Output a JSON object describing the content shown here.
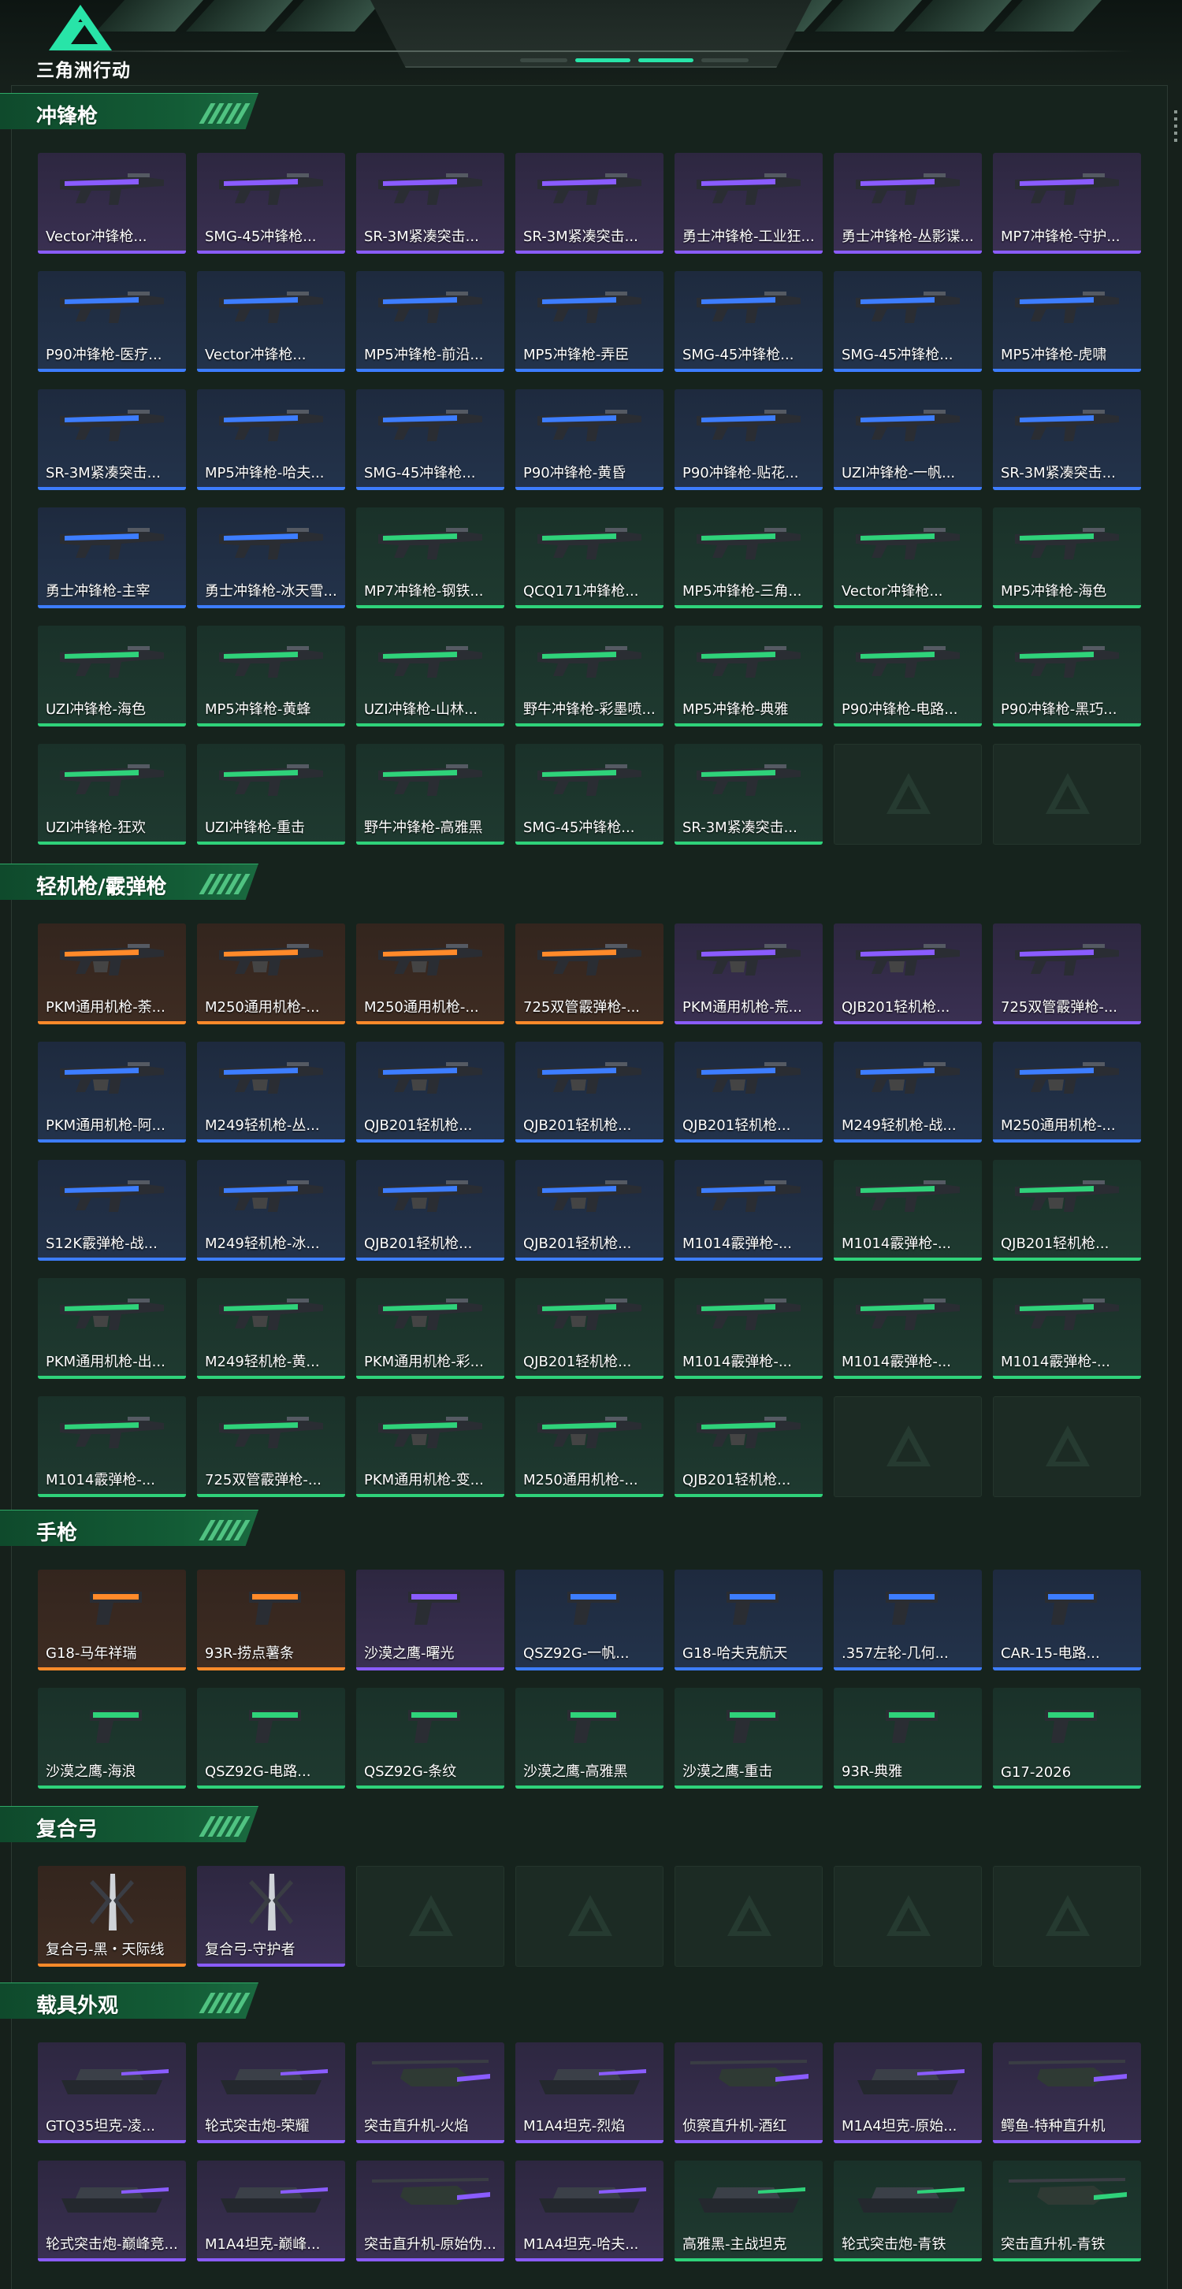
{
  "header": {
    "logo_text": "三角洲行动",
    "accent_color": "#28e4a8"
  },
  "rarity_colors": {
    "purple": "#8a5cff",
    "blue": "#3d7dff",
    "green": "#2fd27a",
    "orange": "#ff8a2a"
  },
  "sections": [
    {
      "title": "冲锋枪",
      "items": [
        {
          "label": "Vector冲锋枪...",
          "rarity": "purple",
          "icon": "smg-icon"
        },
        {
          "label": "SMG-45冲锋枪...",
          "rarity": "purple",
          "icon": "smg-icon"
        },
        {
          "label": "SR-3M紧凑突击...",
          "rarity": "purple",
          "icon": "smg-icon"
        },
        {
          "label": "SR-3M紧凑突击...",
          "rarity": "purple",
          "icon": "smg-icon"
        },
        {
          "label": "勇士冲锋枪-工业狂...",
          "rarity": "purple",
          "icon": "smg-icon"
        },
        {
          "label": "勇士冲锋枪-丛影谍...",
          "rarity": "purple",
          "icon": "smg-icon"
        },
        {
          "label": "MP7冲锋枪-守护...",
          "rarity": "purple",
          "icon": "smg-icon"
        },
        {
          "label": "P90冲锋枪-医疗...",
          "rarity": "blue",
          "icon": "smg-icon"
        },
        {
          "label": "Vector冲锋枪...",
          "rarity": "blue",
          "icon": "smg-icon"
        },
        {
          "label": "MP5冲锋枪-前沿...",
          "rarity": "blue",
          "icon": "smg-icon"
        },
        {
          "label": "MP5冲锋枪-弄臣",
          "rarity": "blue",
          "icon": "smg-icon"
        },
        {
          "label": "SMG-45冲锋枪...",
          "rarity": "blue",
          "icon": "smg-icon"
        },
        {
          "label": "SMG-45冲锋枪...",
          "rarity": "blue",
          "icon": "smg-icon"
        },
        {
          "label": "MP5冲锋枪-虎啸",
          "rarity": "blue",
          "icon": "smg-icon"
        },
        {
          "label": "SR-3M紧凑突击...",
          "rarity": "blue",
          "icon": "smg-icon"
        },
        {
          "label": "MP5冲锋枪-哈夫...",
          "rarity": "blue",
          "icon": "smg-icon"
        },
        {
          "label": "SMG-45冲锋枪...",
          "rarity": "blue",
          "icon": "smg-icon"
        },
        {
          "label": "P90冲锋枪-黄昏",
          "rarity": "blue",
          "icon": "smg-icon"
        },
        {
          "label": "P90冲锋枪-贴花...",
          "rarity": "blue",
          "icon": "smg-icon"
        },
        {
          "label": "UZI冲锋枪-一帆...",
          "rarity": "blue",
          "icon": "smg-icon"
        },
        {
          "label": "SR-3M紧凑突击...",
          "rarity": "blue",
          "icon": "smg-icon"
        },
        {
          "label": "勇士冲锋枪-主宰",
          "rarity": "blue",
          "icon": "smg-icon"
        },
        {
          "label": "勇士冲锋枪-冰天雪...",
          "rarity": "blue",
          "icon": "smg-icon"
        },
        {
          "label": "MP7冲锋枪-钢铁...",
          "rarity": "green",
          "icon": "smg-icon"
        },
        {
          "label": "QCQ171冲锋枪...",
          "rarity": "green",
          "icon": "smg-icon"
        },
        {
          "label": "MP5冲锋枪-三角...",
          "rarity": "green",
          "icon": "smg-icon"
        },
        {
          "label": "Vector冲锋枪...",
          "rarity": "green",
          "icon": "smg-icon"
        },
        {
          "label": "MP5冲锋枪-海色",
          "rarity": "green",
          "icon": "smg-icon"
        },
        {
          "label": "UZI冲锋枪-海色",
          "rarity": "green",
          "icon": "smg-icon"
        },
        {
          "label": "MP5冲锋枪-黄蜂",
          "rarity": "green",
          "icon": "smg-icon"
        },
        {
          "label": "UZI冲锋枪-山林...",
          "rarity": "green",
          "icon": "smg-icon"
        },
        {
          "label": "野牛冲锋枪-彩墨喷...",
          "rarity": "green",
          "icon": "smg-icon"
        },
        {
          "label": "MP5冲锋枪-典雅",
          "rarity": "green",
          "icon": "smg-icon"
        },
        {
          "label": "P90冲锋枪-电路...",
          "rarity": "green",
          "icon": "smg-icon"
        },
        {
          "label": "P90冲锋枪-黑巧...",
          "rarity": "green",
          "icon": "smg-icon"
        },
        {
          "label": "UZI冲锋枪-狂欢",
          "rarity": "green",
          "icon": "smg-icon"
        },
        {
          "label": "UZI冲锋枪-重击",
          "rarity": "green",
          "icon": "smg-icon"
        },
        {
          "label": "野牛冲锋枪-高雅黑",
          "rarity": "green",
          "icon": "smg-icon"
        },
        {
          "label": "SMG-45冲锋枪...",
          "rarity": "green",
          "icon": "smg-icon"
        },
        {
          "label": "SR-3M紧凑突击...",
          "rarity": "green",
          "icon": "smg-icon"
        },
        {
          "label": "",
          "rarity": "empty",
          "icon": "delta-logo-icon"
        },
        {
          "label": "",
          "rarity": "empty",
          "icon": "delta-logo-icon"
        }
      ]
    },
    {
      "title": "轻机枪/霰弹枪",
      "items": [
        {
          "label": "PKM通用机枪-荼...",
          "rarity": "orange",
          "icon": "lmg-icon"
        },
        {
          "label": "M250通用机枪-...",
          "rarity": "orange",
          "icon": "lmg-icon"
        },
        {
          "label": "M250通用机枪-...",
          "rarity": "orange",
          "icon": "lmg-icon"
        },
        {
          "label": "725双管霰弹枪-...",
          "rarity": "orange",
          "icon": "shotgun-icon"
        },
        {
          "label": "PKM通用机枪-荒...",
          "rarity": "purple",
          "icon": "lmg-icon"
        },
        {
          "label": "QJB201轻机枪...",
          "rarity": "purple",
          "icon": "lmg-icon"
        },
        {
          "label": "725双管霰弹枪-...",
          "rarity": "purple",
          "icon": "shotgun-icon"
        },
        {
          "label": "PKM通用机枪-阿...",
          "rarity": "blue",
          "icon": "lmg-icon"
        },
        {
          "label": "M249轻机枪-丛...",
          "rarity": "blue",
          "icon": "lmg-icon"
        },
        {
          "label": "QJB201轻机枪...",
          "rarity": "blue",
          "icon": "lmg-icon"
        },
        {
          "label": "QJB201轻机枪...",
          "rarity": "blue",
          "icon": "lmg-icon"
        },
        {
          "label": "QJB201轻机枪...",
          "rarity": "blue",
          "icon": "lmg-icon"
        },
        {
          "label": "M249轻机枪-战...",
          "rarity": "blue",
          "icon": "lmg-icon"
        },
        {
          "label": "M250通用机枪-...",
          "rarity": "blue",
          "icon": "lmg-icon"
        },
        {
          "label": "S12K霰弹枪-战...",
          "rarity": "blue",
          "icon": "shotgun-icon"
        },
        {
          "label": "M249轻机枪-冰...",
          "rarity": "blue",
          "icon": "lmg-icon"
        },
        {
          "label": "QJB201轻机枪...",
          "rarity": "blue",
          "icon": "lmg-icon"
        },
        {
          "label": "QJB201轻机枪...",
          "rarity": "blue",
          "icon": "lmg-icon"
        },
        {
          "label": "M1014霰弹枪-...",
          "rarity": "blue",
          "icon": "shotgun-icon"
        },
        {
          "label": "M1014霰弹枪-...",
          "rarity": "green",
          "icon": "shotgun-icon"
        },
        {
          "label": "QJB201轻机枪...",
          "rarity": "green",
          "icon": "lmg-icon"
        },
        {
          "label": "PKM通用机枪-出...",
          "rarity": "green",
          "icon": "lmg-icon"
        },
        {
          "label": "M249轻机枪-黄...",
          "rarity": "green",
          "icon": "lmg-icon"
        },
        {
          "label": "PKM通用机枪-彩...",
          "rarity": "green",
          "icon": "lmg-icon"
        },
        {
          "label": "QJB201轻机枪...",
          "rarity": "green",
          "icon": "lmg-icon"
        },
        {
          "label": "M1014霰弹枪-...",
          "rarity": "green",
          "icon": "shotgun-icon"
        },
        {
          "label": "M1014霰弹枪-...",
          "rarity": "green",
          "icon": "shotgun-icon"
        },
        {
          "label": "M1014霰弹枪-...",
          "rarity": "green",
          "icon": "shotgun-icon"
        },
        {
          "label": "M1014霰弹枪-...",
          "rarity": "green",
          "icon": "shotgun-icon"
        },
        {
          "label": "725双管霰弹枪-...",
          "rarity": "green",
          "icon": "shotgun-icon"
        },
        {
          "label": "PKM通用机枪-变...",
          "rarity": "green",
          "icon": "lmg-icon"
        },
        {
          "label": "M250通用机枪-...",
          "rarity": "green",
          "icon": "lmg-icon"
        },
        {
          "label": "QJB201轻机枪...",
          "rarity": "green",
          "icon": "lmg-icon"
        },
        {
          "label": "",
          "rarity": "empty",
          "icon": "delta-logo-icon"
        },
        {
          "label": "",
          "rarity": "empty",
          "icon": "delta-logo-icon"
        }
      ]
    },
    {
      "title": "手枪",
      "items": [
        {
          "label": "G18-马年祥瑞",
          "rarity": "orange",
          "icon": "pistol-icon"
        },
        {
          "label": "93R-捞点薯条",
          "rarity": "orange",
          "icon": "pistol-icon"
        },
        {
          "label": "沙漠之鹰-曙光",
          "rarity": "purple",
          "icon": "pistol-icon"
        },
        {
          "label": "QSZ92G-一帆...",
          "rarity": "blue",
          "icon": "pistol-icon"
        },
        {
          "label": "G18-哈夫克航天",
          "rarity": "blue",
          "icon": "pistol-icon"
        },
        {
          "label": ".357左轮-几何...",
          "rarity": "blue",
          "icon": "revolver-icon"
        },
        {
          "label": "CAR-15-电路...",
          "rarity": "blue",
          "icon": "pistol-icon"
        },
        {
          "label": "沙漠之鹰-海浪",
          "rarity": "green",
          "icon": "pistol-icon"
        },
        {
          "label": "QSZ92G-电路...",
          "rarity": "green",
          "icon": "pistol-icon"
        },
        {
          "label": "QSZ92G-条纹",
          "rarity": "green",
          "icon": "pistol-icon"
        },
        {
          "label": "沙漠之鹰-高雅黑",
          "rarity": "green",
          "icon": "pistol-icon"
        },
        {
          "label": "沙漠之鹰-重击",
          "rarity": "green",
          "icon": "pistol-icon"
        },
        {
          "label": "93R-典雅",
          "rarity": "green",
          "icon": "pistol-icon"
        },
        {
          "label": "G17-2026",
          "rarity": "green",
          "icon": "pistol-icon"
        }
      ]
    },
    {
      "title": "复合弓",
      "items": [
        {
          "label": "复合弓-黑・天际线",
          "rarity": "orange",
          "icon": "bow-icon"
        },
        {
          "label": "复合弓-守护者",
          "rarity": "purple",
          "icon": "bow-icon"
        },
        {
          "label": "",
          "rarity": "empty",
          "icon": "delta-logo-icon"
        },
        {
          "label": "",
          "rarity": "empty",
          "icon": "delta-logo-icon"
        },
        {
          "label": "",
          "rarity": "empty",
          "icon": "delta-logo-icon"
        },
        {
          "label": "",
          "rarity": "empty",
          "icon": "delta-logo-icon"
        },
        {
          "label": "",
          "rarity": "empty",
          "icon": "delta-logo-icon"
        }
      ]
    },
    {
      "title": "载具外观",
      "items": [
        {
          "label": "GTQ35坦克-凌...",
          "rarity": "purple",
          "icon": "tank-icon"
        },
        {
          "label": "轮式突击炮-荣耀",
          "rarity": "purple",
          "icon": "armored-car-icon"
        },
        {
          "label": "突击直升机-火焰",
          "rarity": "purple",
          "icon": "helicopter-icon"
        },
        {
          "label": "M1A4坦克-烈焰",
          "rarity": "purple",
          "icon": "tank-icon"
        },
        {
          "label": "侦察直升机-酒红",
          "rarity": "purple",
          "icon": "helicopter-icon"
        },
        {
          "label": "M1A4坦克-原始...",
          "rarity": "purple",
          "icon": "tank-icon"
        },
        {
          "label": "鳄鱼-特种直升机",
          "rarity": "purple",
          "icon": "helicopter-icon"
        },
        {
          "label": "轮式突击炮-巅峰竞...",
          "rarity": "purple",
          "icon": "armored-car-icon"
        },
        {
          "label": "M1A4坦克-巅峰...",
          "rarity": "purple",
          "icon": "tank-icon"
        },
        {
          "label": "突击直升机-原始伪...",
          "rarity": "purple",
          "icon": "helicopter-icon"
        },
        {
          "label": "M1A4坦克-哈夫...",
          "rarity": "purple",
          "icon": "tank-icon"
        },
        {
          "label": "高雅黑-主战坦克",
          "rarity": "green",
          "icon": "tank-icon"
        },
        {
          "label": "轮式突击炮-青铁",
          "rarity": "green",
          "icon": "armored-car-icon"
        },
        {
          "label": "突击直升机-青铁",
          "rarity": "green",
          "icon": "helicopter-icon"
        }
      ]
    }
  ]
}
